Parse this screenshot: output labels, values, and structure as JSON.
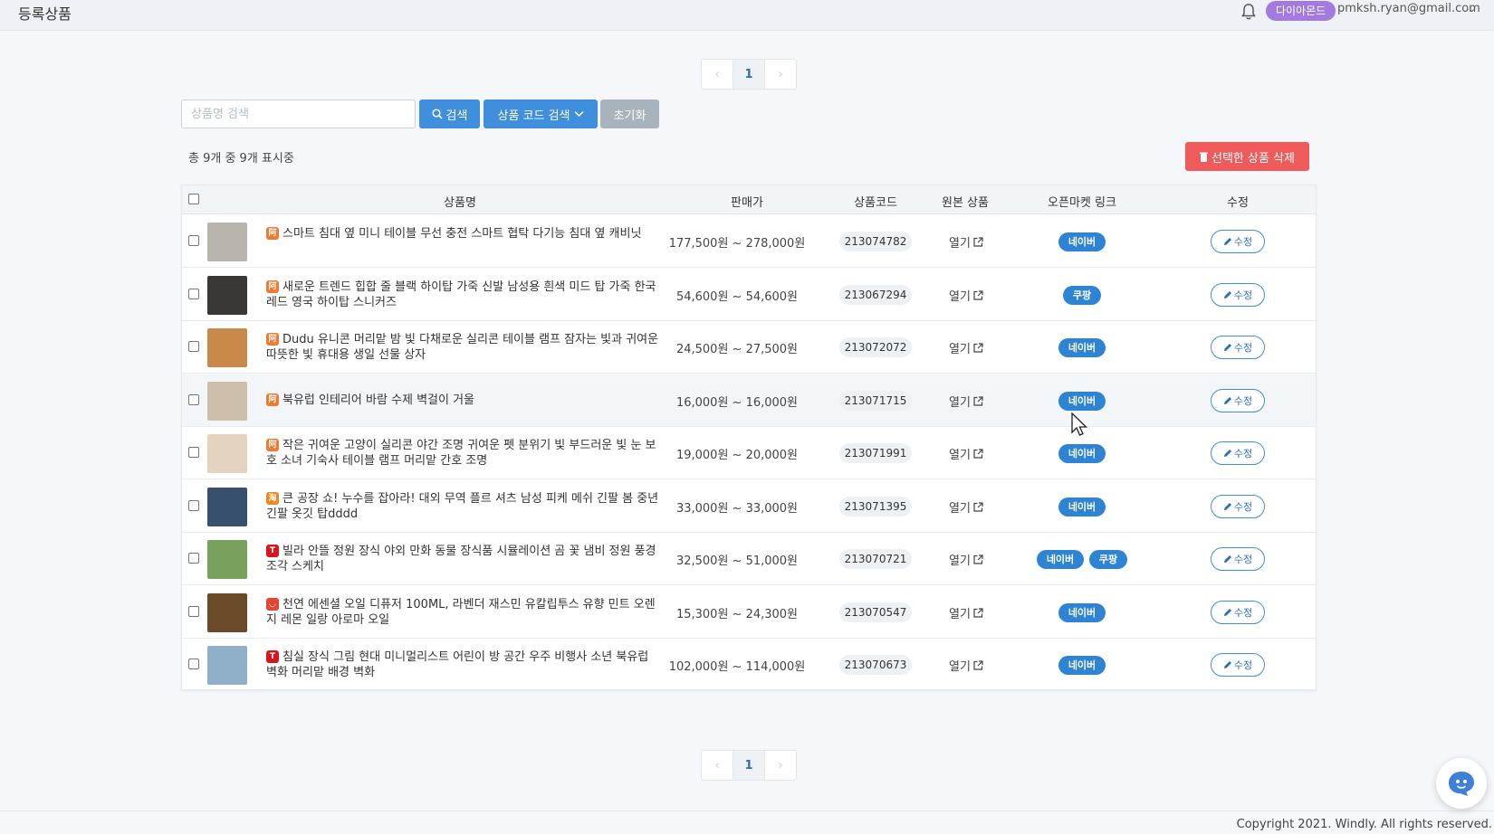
{
  "header": {
    "title": "등록상품",
    "badge": "다이아몬드",
    "email": "pmksh.ryan@gmail.com",
    "caret": "⌄"
  },
  "pagination": {
    "prev": "‹",
    "current": "1",
    "next": "›"
  },
  "toolbar": {
    "search_placeholder": "상품명 검색",
    "search_label": "검색",
    "code_search_label": "상품 코드 검색",
    "reset_label": "초기화",
    "delete_label": "선택한 상품 삭제"
  },
  "count_text": "총 9개 중 9개 표시중",
  "table": {
    "headers": {
      "name": "상품명",
      "price": "판매가",
      "code": "상품코드",
      "original": "원본 상품",
      "market": "오픈마켓 링크",
      "edit": "수정"
    },
    "open_label": "열기",
    "edit_label": "수정",
    "rows": [
      {
        "name": "스마트 침대 옆 미니 테이블 무선 충전 스마트 협탁 다기능 침대 옆 캐비닛",
        "price": "177,500원 ~ 278,000원",
        "code": "213074782",
        "markets": [
          "네이버"
        ],
        "source": "1688",
        "source_color": "#f07a2f",
        "source_mark": "阿",
        "thumb_color": "#b9b5ae"
      },
      {
        "name": "새로운 트렌드 힙합 줄 블랙 하이탑 가죽 신발 남성용 흰색 미드 탑 가죽 한국 레드 영국 하이탑 스니커즈",
        "price": "54,600원 ~ 54,600원",
        "code": "213067294",
        "markets": [
          "쿠팡"
        ],
        "source": "1688",
        "source_color": "#f07a2f",
        "source_mark": "阿",
        "thumb_color": "#3a3836"
      },
      {
        "name": "Dudu 유니콘 머리맡 밤 빛 다채로운 실리콘 테이블 램프 잠자는 빛과 귀여운 따뜻한 빛 휴대용 생일 선물 상자",
        "price": "24,500원 ~ 27,500원",
        "code": "213072072",
        "markets": [
          "네이버"
        ],
        "source": "1688",
        "source_color": "#f07a2f",
        "source_mark": "阿",
        "thumb_color": "#c9894a"
      },
      {
        "name": "북유럽 인테리어 바람 수제 벽걸이 거울",
        "price": "16,000원 ~ 16,000원",
        "code": "213071715",
        "markets": [
          "네이버"
        ],
        "source": "1688",
        "source_color": "#f07a2f",
        "source_mark": "阿",
        "thumb_color": "#cdbfa9",
        "highlight": true
      },
      {
        "name": "작은 귀여운 고양이 실리콘 야간 조명 귀여운 펫 분위기 빛 부드러운 빛 눈 보호 소녀 기숙사 테이블 램프 머리맡 간호 조명",
        "price": "19,000원 ~ 20,000원",
        "code": "213071991",
        "markets": [
          "네이버"
        ],
        "source": "1688",
        "source_color": "#f07a2f",
        "source_mark": "阿",
        "thumb_color": "#e3d3bf"
      },
      {
        "name": "큰 공장 쇼! 누수를 잡아라! 대외 무역 플르 셔츠 남성 피케 메쉬 긴팔 봄 중년 긴팔 옷깃 탑dddd",
        "price": "33,000원 ~ 33,000원",
        "code": "213071395",
        "markets": [
          "네이버"
        ],
        "source": "Taobao",
        "source_color": "#f2861e",
        "source_mark": "淘",
        "thumb_color": "#36506e"
      },
      {
        "name": "빌라 안뜰 정원 장식 야외 만화 동물 장식품 시뮬레이션 곰 꽃 냄비 정원 풍경 조각 스케치",
        "price": "32,500원 ~ 51,000원",
        "code": "213070721",
        "markets": [
          "네이버",
          "쿠팡"
        ],
        "source": "Tmall",
        "source_color": "#d8141c",
        "source_mark": "T",
        "thumb_color": "#7aa15c"
      },
      {
        "name": "천연 에센셜 오일 디퓨저 100ML, 라벤더 재스민 유칼립투스 유향 민트 오렌지 레몬 일랑 아로마 오일",
        "price": "15,300원 ~ 24,300원",
        "code": "213070547",
        "markets": [
          "네이버"
        ],
        "source": "AliExpress",
        "source_color": "#e8432f",
        "source_mark": "◡",
        "thumb_color": "#6b4a2a"
      },
      {
        "name": "침실 장식 그림 현대 미니멀리스트 어린이 방 공간 우주 비행사 소년 북유럽 벽화 머리맡 배경 벽화",
        "price": "102,000원 ~ 114,000원",
        "code": "213070673",
        "markets": [
          "네이버"
        ],
        "source": "Tmall",
        "source_color": "#d8141c",
        "source_mark": "T",
        "thumb_color": "#8fb0c8"
      }
    ]
  },
  "footer": {
    "copyright": "Copyright 2021. Windly. All rights reserved."
  },
  "colors": {
    "primary": "#3f8fdc",
    "danger": "#ef5b5b",
    "badge": "#a37be0",
    "market": "#2d84d4"
  }
}
